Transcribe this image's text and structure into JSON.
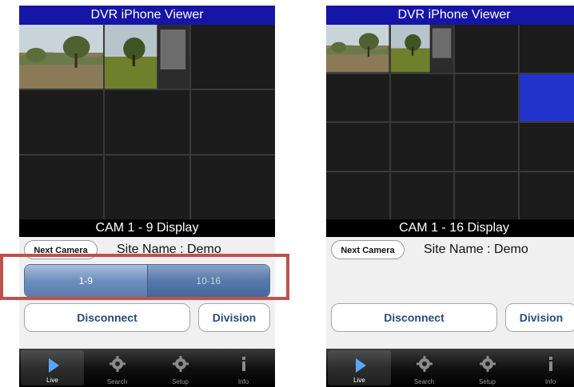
{
  "left": {
    "title": "DVR iPhone Viewer",
    "display_label": "CAM 1 - 9 Display",
    "next_camera_label": "Next Camera",
    "site_name": "Site Name :  Demo",
    "segments": [
      "1-9",
      "10-16"
    ],
    "active_segment": "1-9",
    "disconnect_label": "Disconnect",
    "division_label": "Division"
  },
  "right": {
    "title": "DVR iPhone Viewer",
    "display_label": "CAM 1 - 16 Display",
    "next_camera_label": "Next Camera",
    "site_name": "Site Name :  Demo",
    "disconnect_label": "Disconnect",
    "division_label": "Division"
  },
  "tabs": [
    {
      "label": "Live",
      "icon": "play-icon",
      "active": true
    },
    {
      "label": "Search",
      "icon": "gear-icon",
      "active": false
    },
    {
      "label": "Setup",
      "icon": "gear-icon",
      "active": false
    },
    {
      "label": "Info",
      "icon": "info-icon",
      "active": false
    }
  ],
  "colors": {
    "title_bar": "#1515a6",
    "selected_cell": "#2233cc",
    "highlight_box": "#c0504d",
    "button_text": "#2b4a7a"
  }
}
